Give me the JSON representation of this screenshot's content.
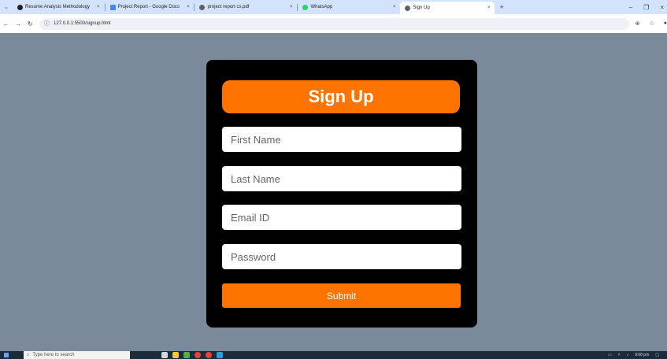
{
  "browser": {
    "tabs": [
      {
        "label": "Resume Analysis Methodology",
        "color": "#202020",
        "active": false
      },
      {
        "label": "Project Report - Google Docs",
        "color": "#4285f4",
        "active": false
      },
      {
        "label": "project report cs.pdf",
        "color": "#5f6368",
        "active": false
      },
      {
        "label": "WhatsApp",
        "color": "#25d366",
        "active": false
      },
      {
        "label": "Sign Up",
        "color": "#5f6368",
        "active": true
      }
    ],
    "close_glyph": "×",
    "new_tab_glyph": "+",
    "url": "127.0.0.1:5500/signup.html"
  },
  "form": {
    "title": "Sign Up",
    "first_name_placeholder": "First Name",
    "last_name_placeholder": "Last Name",
    "email_placeholder": "Email ID",
    "password_placeholder": "Password",
    "submit_label": "Submit"
  },
  "taskbar": {
    "search_placeholder": "Type here to search",
    "time": "9:08 pm"
  },
  "colors": {
    "page_bg": "#7a8a9a",
    "card_bg": "#000000",
    "accent": "#ff7400"
  }
}
